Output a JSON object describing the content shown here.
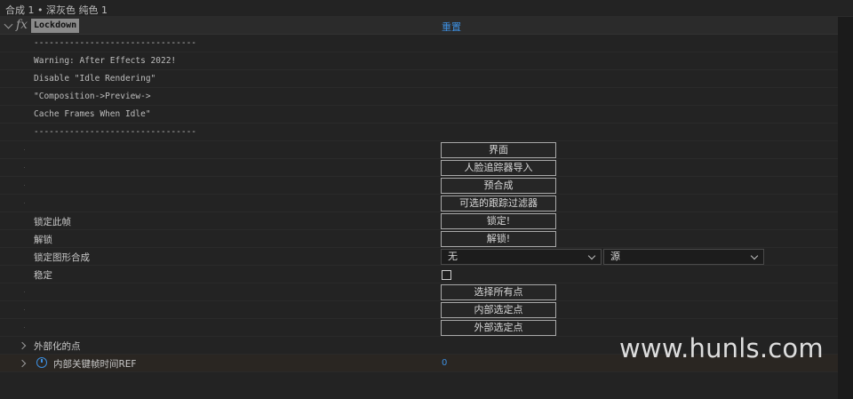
{
  "breadcrumb": "合成 1 • 深灰色 纯色 1",
  "effect": {
    "name": "Lockdown",
    "reset_label": "重置"
  },
  "notes": [
    "--------------------------------",
    "Warning: After Effects 2022!",
    "Disable \"Idle Rendering\"",
    "\"Composition->Preview->",
    "Cache Frames When Idle\"",
    "--------------------------------"
  ],
  "buttons": {
    "interface": "界面",
    "face_tracker_import": "人脸追踪器导入",
    "precompose": "预合成",
    "optional_tracking_filter": "可选的跟踪过滤器",
    "lock": "锁定!",
    "unlock": "解锁!",
    "select_all_points": "选择所有点",
    "internal_select_points": "内部选定点",
    "external_select_points": "外部选定点"
  },
  "labels": {
    "lock_frame": "锁定此帧",
    "unlock": "解锁",
    "lock_shape_comp": "锁定图形合成",
    "stabilize": "稳定",
    "externalized_points": "外部化的点",
    "internal_keyframe_ref": "内部关键帧时间REF"
  },
  "selects": {
    "layer": "无",
    "source": "源"
  },
  "stabilize_checked": false,
  "keyframe_ref_value": "0",
  "watermark": "www.hunls.com"
}
